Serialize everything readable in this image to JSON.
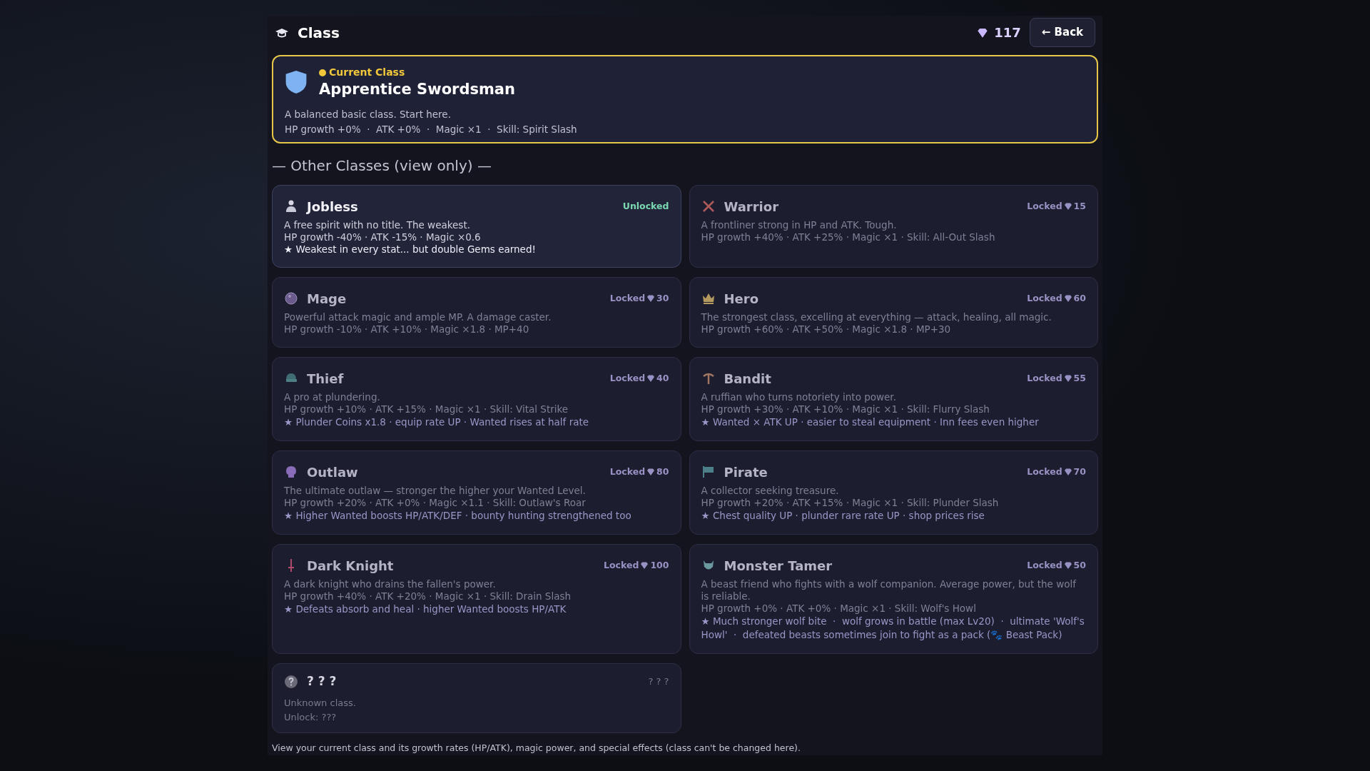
{
  "header": {
    "title": "Class",
    "gems": "117",
    "back_button": "← Back"
  },
  "current_class": {
    "badge": "Current Class",
    "name": "Apprentice Swordsman",
    "description": "A balanced basic class. Start here.",
    "stats": "HP growth +0%  ·  ATK +0%  ·  Magic ×1  ·  Skill: Spirit Slash"
  },
  "section_title": "— Other Classes (view only) —",
  "classes": [
    {
      "kind": "class",
      "name": "Jobless",
      "unlocked": true,
      "status": "Unlocked",
      "description": "A free spirit with no title. The weakest.",
      "stats": "HP growth -40% · ATK -15% · Magic ×0.6",
      "effect": "★ Weakest in every stat... but double Gems earned!"
    },
    {
      "kind": "class",
      "name": "Warrior",
      "unlocked": false,
      "status": "Locked",
      "cost": "15",
      "description": "A frontliner strong in HP and ATK. Tough.",
      "stats": "HP growth +40% · ATK +25% · Magic ×1 · Skill: All-Out Slash"
    },
    {
      "kind": "class",
      "name": "Mage",
      "unlocked": false,
      "status": "Locked",
      "cost": "30",
      "description": "Powerful attack magic and ample MP. A damage caster.",
      "stats": "HP growth -10% · ATK +10% · Magic ×1.8 · MP+40"
    },
    {
      "kind": "class",
      "name": "Hero",
      "unlocked": false,
      "status": "Locked",
      "cost": "60",
      "description": "The strongest class, excelling at everything — attack, healing, all magic.",
      "stats": "HP growth +60% · ATK +50% · Magic ×1.8 · MP+30"
    },
    {
      "kind": "class",
      "name": "Thief",
      "unlocked": false,
      "status": "Locked",
      "cost": "40",
      "description": "A pro at plundering.",
      "stats": "HP growth +10% · ATK +15% · Magic ×1 · Skill: Vital Strike",
      "effect": "★ Plunder Coins x1.8 · equip rate UP · Wanted rises at half rate"
    },
    {
      "kind": "class",
      "name": "Bandit",
      "unlocked": false,
      "status": "Locked",
      "cost": "55",
      "description": "A ruffian who turns notoriety into power.",
      "stats": "HP growth +30% · ATK +10% · Magic ×1 · Skill: Flurry Slash",
      "effect": "★ Wanted × ATK UP · easier to steal equipment · Inn fees even higher"
    },
    {
      "kind": "class",
      "name": "Outlaw",
      "unlocked": false,
      "status": "Locked",
      "cost": "80",
      "description": "The ultimate outlaw — stronger the higher your Wanted Level.",
      "stats": "HP growth +20% · ATK +0% · Magic ×1.1 · Skill: Outlaw's Roar",
      "effect": "★ Higher Wanted boosts HP/ATK/DEF · bounty hunting strengthened too"
    },
    {
      "kind": "class",
      "name": "Pirate",
      "unlocked": false,
      "status": "Locked",
      "cost": "70",
      "description": "A collector seeking treasure.",
      "stats": "HP growth +20% · ATK +15% · Magic ×1 · Skill: Plunder Slash",
      "effect": "★ Chest quality UP · plunder rare rate UP · shop prices rise"
    },
    {
      "kind": "class",
      "name": "Dark Knight",
      "unlocked": false,
      "status": "Locked",
      "cost": "100",
      "description": "A dark knight who drains the fallen's power.",
      "stats": "HP growth +40% · ATK +20% · Magic ×1 · Skill: Drain Slash",
      "effect": "★ Defeats absorb and heal · higher Wanted boosts HP/ATK"
    },
    {
      "kind": "class",
      "name": "Monster Tamer",
      "unlocked": false,
      "status": "Locked",
      "cost": "50",
      "description": "A beast friend who fights with a wolf companion. Average power, but the wolf is reliable.",
      "stats": "HP growth +0% · ATK +0% · Magic ×1 · Skill: Wolf's Howl",
      "effect": "★ Much stronger wolf bite  ·  wolf grows in battle (max Lv20)  ·  ultimate 'Wolf's Howl'  ·  defeated beasts sometimes join to fight as a pack (🐾 Beast Pack)"
    },
    {
      "kind": "unknown",
      "name": "? ? ?",
      "status": "? ? ?",
      "description": "Unknown class.",
      "stats": "Unlock: ???"
    }
  ],
  "footer": "View your current class and its growth rates (HP/ATK), magic power, and special effects (class can't be changed here)."
}
